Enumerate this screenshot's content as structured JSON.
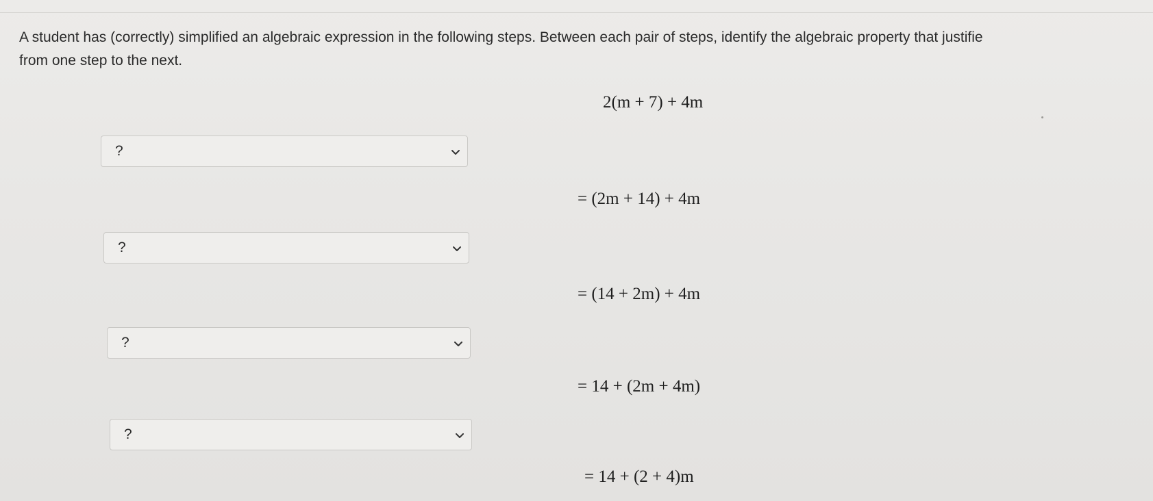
{
  "question": {
    "line1": "A student has (correctly) simplified an algebraic expression in the following steps. Between each pair of steps, identify the algebraic property that justifie",
    "line2": "from one step to the next."
  },
  "steps": [
    "2(m + 7) + 4m",
    "= (2m + 14) + 4m",
    "= (14 + 2m) + 4m",
    "= 14 + (2m + 4m)",
    "= 14 + (2 + 4)m"
  ],
  "dropdowns": [
    {
      "value": "?",
      "icon": "chevron-down-icon"
    },
    {
      "value": "?",
      "icon": "chevron-down-icon"
    },
    {
      "value": "?",
      "icon": "chevron-down-icon"
    },
    {
      "value": "?",
      "icon": "chevron-down-icon"
    }
  ]
}
